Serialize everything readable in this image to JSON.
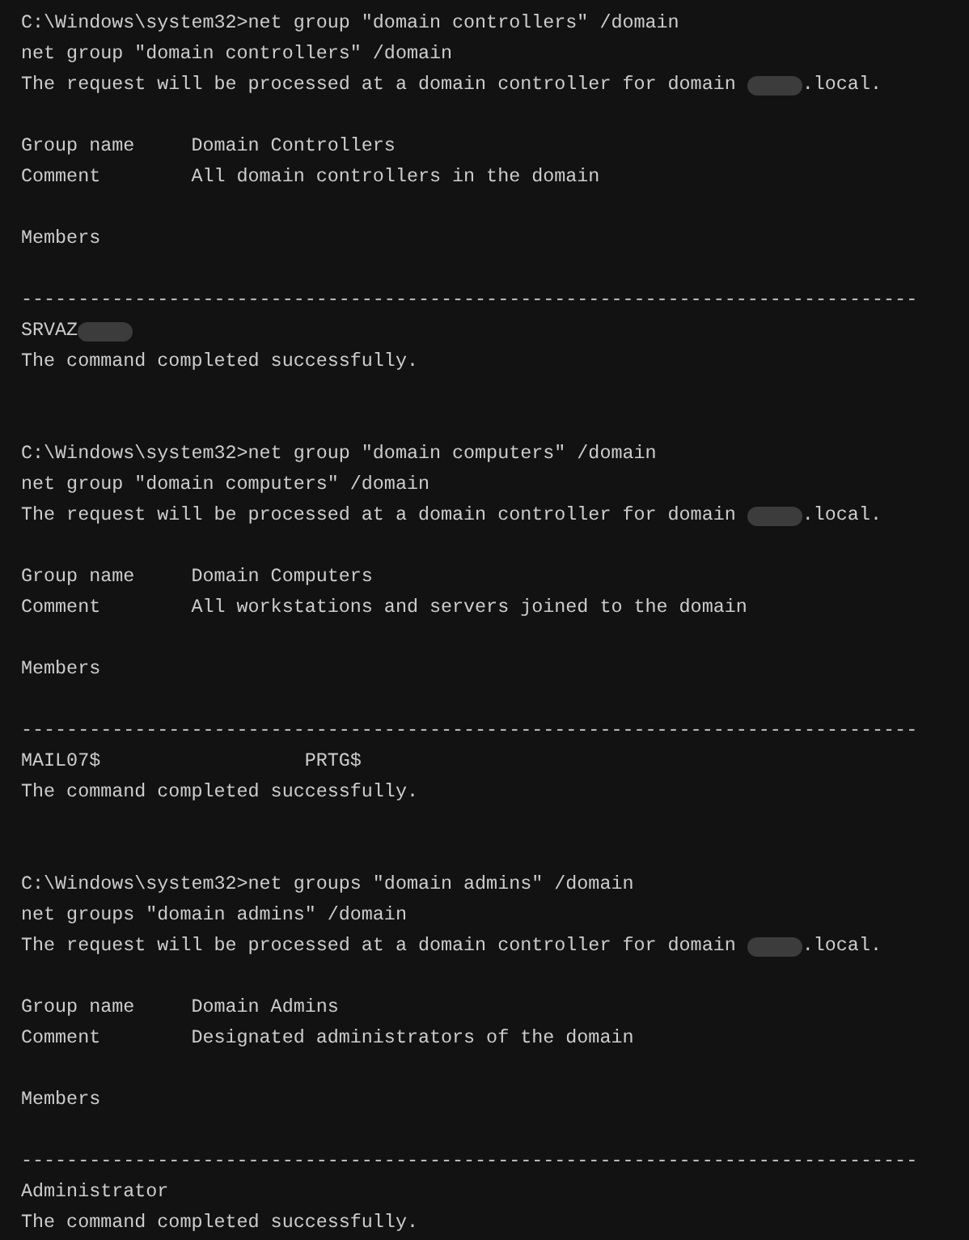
{
  "terminal": {
    "lines": [
      {
        "kind": "text",
        "text": "C:\\Windows\\system32>net group \"domain controllers\" /domain"
      },
      {
        "kind": "text",
        "text": "net group \"domain controllers\" /domain"
      },
      {
        "kind": "redacted",
        "before": "The request will be processed at a domain controller for domain ",
        "after": ".local."
      },
      {
        "kind": "blank"
      },
      {
        "kind": "text",
        "text": "Group name     Domain Controllers"
      },
      {
        "kind": "text",
        "text": "Comment        All domain controllers in the domain"
      },
      {
        "kind": "blank"
      },
      {
        "kind": "text",
        "text": "Members"
      },
      {
        "kind": "blank"
      },
      {
        "kind": "rule",
        "text": "-------------------------------------------------------------------------------"
      },
      {
        "kind": "redacted",
        "before": "SRVAZ"
      },
      {
        "kind": "text",
        "text": "The command completed successfully."
      },
      {
        "kind": "blank"
      },
      {
        "kind": "blank"
      },
      {
        "kind": "text",
        "text": "C:\\Windows\\system32>net group \"domain computers\" /domain"
      },
      {
        "kind": "text",
        "text": "net group \"domain computers\" /domain"
      },
      {
        "kind": "redacted",
        "before": "The request will be processed at a domain controller for domain ",
        "after": ".local."
      },
      {
        "kind": "blank"
      },
      {
        "kind": "text",
        "text": "Group name     Domain Computers"
      },
      {
        "kind": "text",
        "text": "Comment        All workstations and servers joined to the domain"
      },
      {
        "kind": "blank"
      },
      {
        "kind": "text",
        "text": "Members"
      },
      {
        "kind": "blank"
      },
      {
        "kind": "rule",
        "text": "-------------------------------------------------------------------------------"
      },
      {
        "kind": "text",
        "text": "MAIL07$                  PRTG$"
      },
      {
        "kind": "text",
        "text": "The command completed successfully."
      },
      {
        "kind": "blank"
      },
      {
        "kind": "blank"
      },
      {
        "kind": "text",
        "text": "C:\\Windows\\system32>net groups \"domain admins\" /domain"
      },
      {
        "kind": "text",
        "text": "net groups \"domain admins\" /domain"
      },
      {
        "kind": "redacted",
        "before": "The request will be processed at a domain controller for domain ",
        "after": ".local."
      },
      {
        "kind": "blank"
      },
      {
        "kind": "text",
        "text": "Group name     Domain Admins"
      },
      {
        "kind": "text",
        "text": "Comment        Designated administrators of the domain"
      },
      {
        "kind": "blank"
      },
      {
        "kind": "text",
        "text": "Members"
      },
      {
        "kind": "blank"
      },
      {
        "kind": "rule",
        "text": "-------------------------------------------------------------------------------"
      },
      {
        "kind": "text",
        "text": "Administrator"
      },
      {
        "kind": "text",
        "text": "The command completed successfully."
      }
    ]
  }
}
